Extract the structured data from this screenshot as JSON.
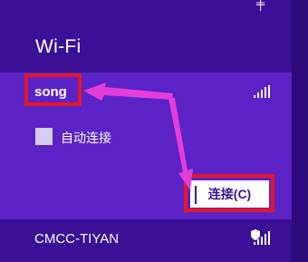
{
  "panel": {
    "title": "Wi-Fi"
  },
  "networks": [
    {
      "name": "song",
      "signal_icon": "signal-bars-icon",
      "auto_connect_label": "自动连接",
      "auto_connect_checked": false,
      "connect_label": "连接(C)"
    },
    {
      "name": "CMCC-TIYAN",
      "signal_icon": "secured-signal-bars-icon"
    }
  ],
  "colors": {
    "panel_bg": "#3a1096",
    "selected_bg": "#5b22c5",
    "highlight_red": "#e5162b",
    "arrow_magenta": "#e43ed8"
  }
}
